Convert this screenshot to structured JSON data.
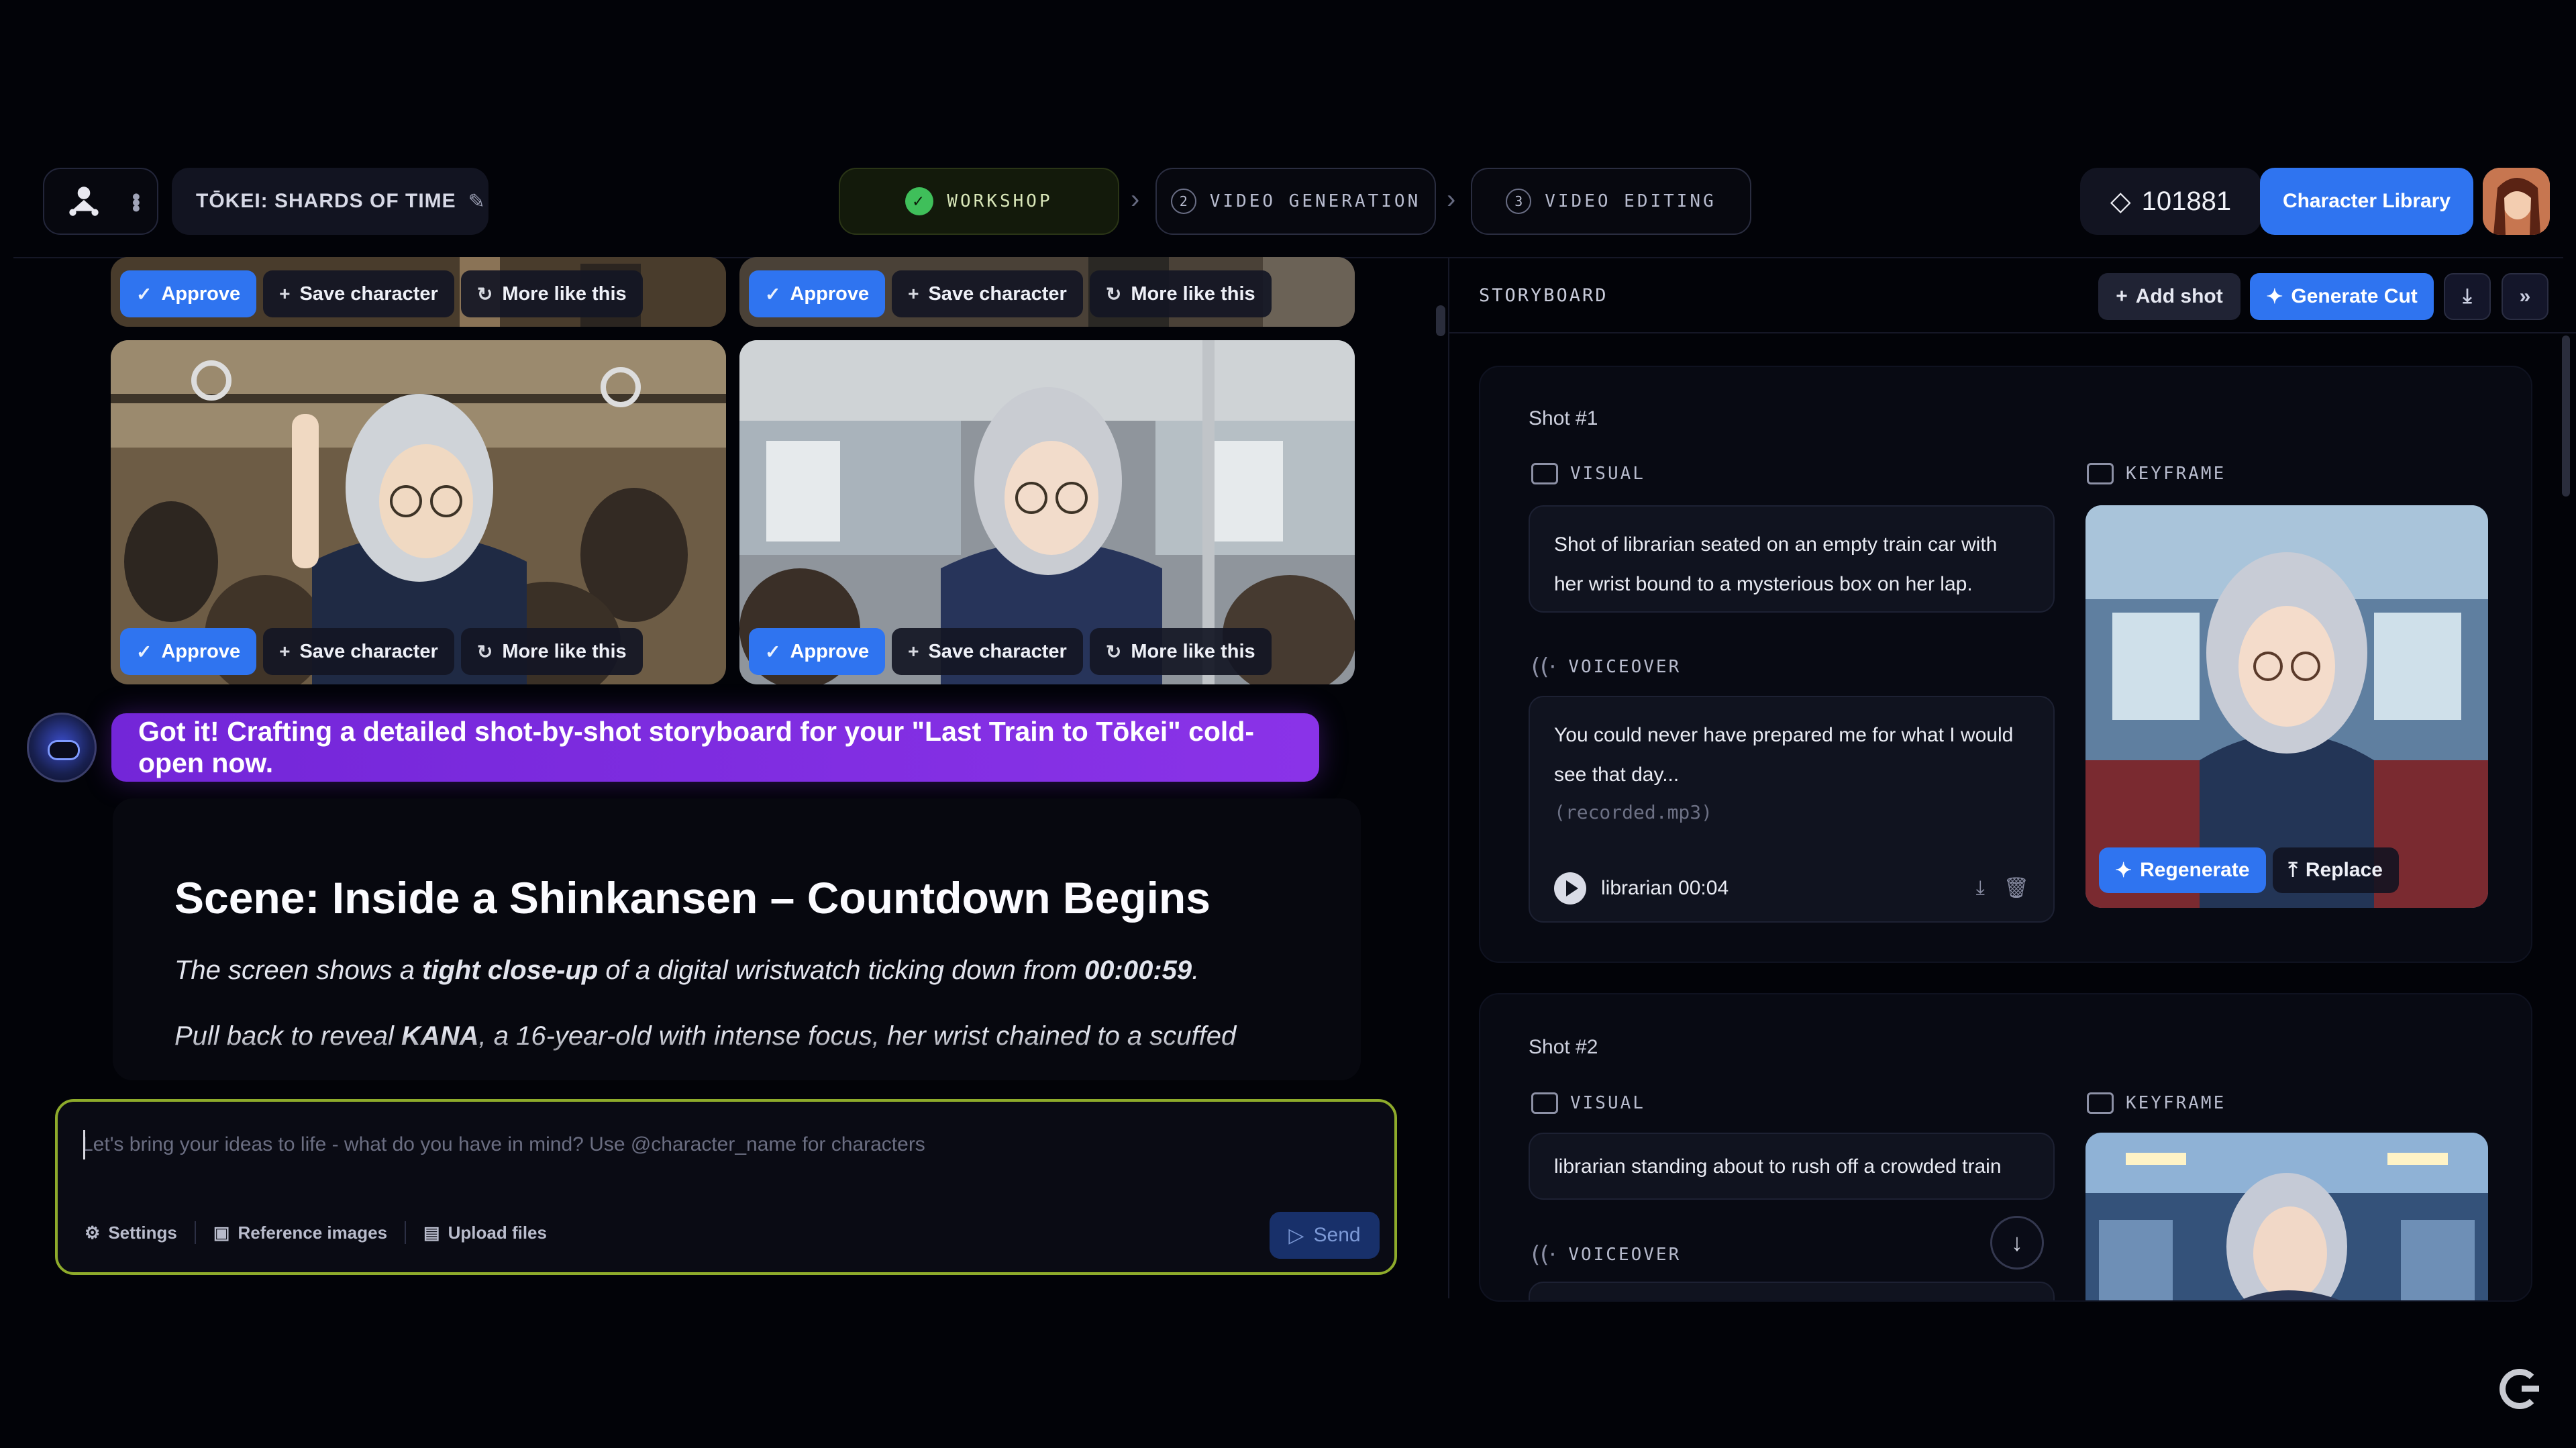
{
  "header": {
    "project_name": "TŌKEI: SHARDS OF TIME",
    "steps": [
      {
        "num": "",
        "label": "WORKSHOP",
        "state": "done"
      },
      {
        "num": "2",
        "label": "VIDEO GENERATION",
        "state": "pending"
      },
      {
        "num": "3",
        "label": "VIDEO EDITING",
        "state": "pending"
      }
    ],
    "credits": "101881",
    "character_library": "Character Library"
  },
  "gallery": {
    "approve": "Approve",
    "save_character": "Save character",
    "more_like_this": "More like this"
  },
  "chat": {
    "bot_message": "Got it! Crafting a detailed shot-by-shot storyboard for your \"Last Train to Tōkei\" cold-open now."
  },
  "scene": {
    "title": "Scene: Inside a Shinkansen – Countdown Begins",
    "p1_a": "The screen shows a ",
    "p1_b": "tight close-up",
    "p1_c": " of a digital wristwatch ticking down from ",
    "p1_d": "00:00:59",
    "p1_e": ".",
    "p2_a": "Pull back to reveal ",
    "p2_b": "KANA",
    "p2_c": ", a 16-year-old with intense focus, her wrist chained to a scuffed"
  },
  "composer": {
    "placeholder": "Let's bring your ideas to life - what do you have in mind? Use @character_name for characters",
    "settings": "Settings",
    "reference_images": "Reference images",
    "upload_files": "Upload files",
    "send": "Send"
  },
  "storyboard": {
    "title": "STORYBOARD",
    "add_shot": "Add shot",
    "generate_cut": "Generate Cut",
    "visual_label": "VISUAL",
    "keyframe_label": "KEYFRAME",
    "voiceover_label": "VOICEOVER",
    "regenerate": "Regenerate",
    "replace": "Replace",
    "shots": [
      {
        "title": "Shot #1",
        "visual": "Shot of librarian seated on an empty train car with her wrist bound to a mysterious box on her lap.",
        "voiceover": "You could never have prepared me for what I would see that day...",
        "recorded": "(recorded.mp3)",
        "audio": "librarian 00:04"
      },
      {
        "title": "Shot #2",
        "visual": "librarian standing about to rush off a crowded train"
      }
    ]
  },
  "colors": {
    "accent_blue": "#2f74f0",
    "bot_purple": "#8a33e8",
    "composer_border": "#8eab2b",
    "success_green": "#3fbf5a"
  }
}
